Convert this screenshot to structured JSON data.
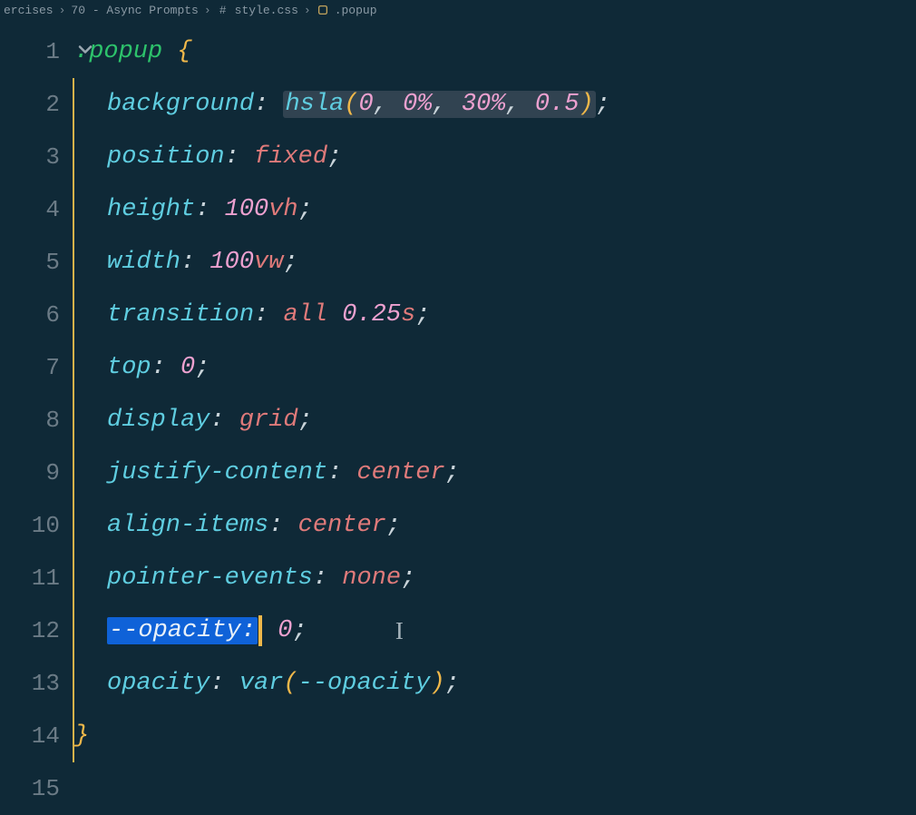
{
  "breadcrumb": {
    "parts": [
      "ercises",
      "70 - Async Prompts",
      "style.css",
      ".popup"
    ],
    "file_icon": "#",
    "symbol_icon": "⚙"
  },
  "editor": {
    "selector": ".popup",
    "brace_open": "{",
    "brace_close": "}",
    "lines": [
      {
        "n": "1",
        "kind": "selector"
      },
      {
        "n": "2",
        "prop": "background",
        "fn": "hsla",
        "args": [
          "0",
          "0%",
          "30%",
          "0.5"
        ],
        "highlight_args": true
      },
      {
        "n": "3",
        "prop": "position",
        "val": "fixed",
        "keyword": true
      },
      {
        "n": "4",
        "prop": "height",
        "num": "100",
        "unit": "vh"
      },
      {
        "n": "5",
        "prop": "width",
        "num": "100",
        "unit": "vw"
      },
      {
        "n": "6",
        "prop": "transition",
        "raw": true,
        "tokens": [
          {
            "t": "all",
            "c": "kw"
          },
          {
            "t": " ",
            "c": "plain"
          },
          {
            "t": "0.25",
            "c": "num"
          },
          {
            "t": "s",
            "c": "kw"
          }
        ]
      },
      {
        "n": "7",
        "prop": "top",
        "num": "0"
      },
      {
        "n": "8",
        "prop": "display",
        "val": "grid",
        "keyword": true
      },
      {
        "n": "9",
        "prop": "justify-content",
        "val": "center",
        "keyword": true
      },
      {
        "n": "10",
        "prop": "align-items",
        "val": "center",
        "keyword": true
      },
      {
        "n": "11",
        "prop": "pointer-events",
        "val": "none",
        "keyword": true
      },
      {
        "n": "12",
        "prop": "--opacity",
        "num": "0",
        "selected": true,
        "caret_after_colon": true,
        "ibeam": true
      },
      {
        "n": "13",
        "prop": "opacity",
        "fn": "var",
        "cssvar": "--opacity"
      },
      {
        "n": "14",
        "kind": "close"
      },
      {
        "n": "15",
        "kind": "blank"
      }
    ]
  }
}
